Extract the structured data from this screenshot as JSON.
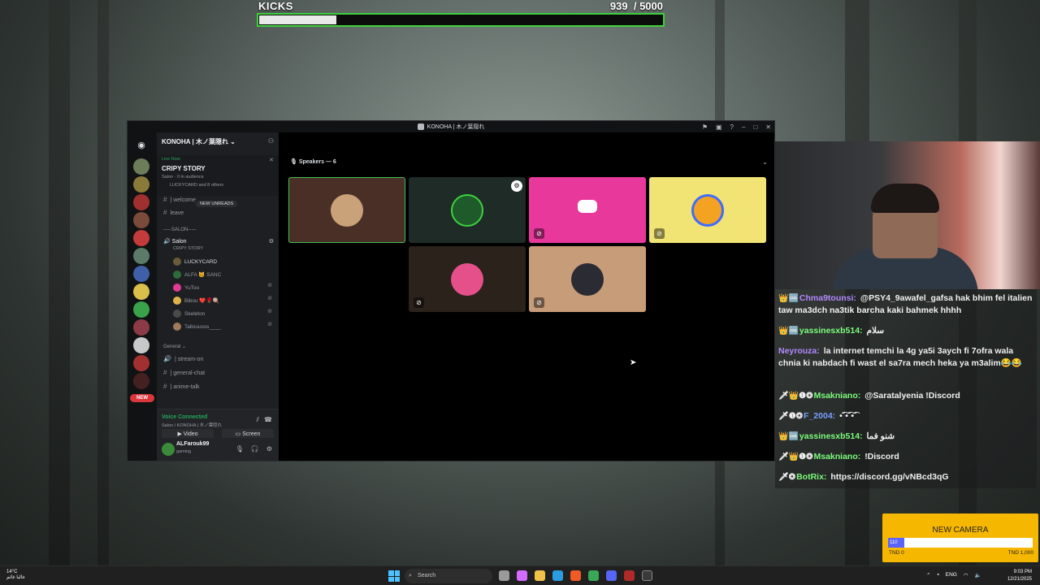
{
  "kicks": {
    "title": "KICKS",
    "count": "939",
    "goal": "/ 5000",
    "progress": 0.19
  },
  "discord": {
    "window_title": "KONOHA | 木ノ葉隠れ",
    "server_name": "KONOHA | 木ノ葉隠れ",
    "live_now": "Live Now",
    "live_title": "CRIPY STORY",
    "live_sub": "Salon · 0 in audience",
    "live_members": "LUCKYCARD and 8 others",
    "channels": {
      "welcome": "| welcome",
      "new_unreads": "NEW UNREADS",
      "leave": "leave",
      "salon_header": "-----SALON-----",
      "salon": "Salon",
      "salon_sub": "CRIPY STORY",
      "general_header": "General",
      "stream_on": "| stream-on",
      "general_chat": "| general-chat",
      "anime_talk": "| anime-talk"
    },
    "members": [
      "LUCKYCARD",
      "ALFA 🐱 SANC",
      "YuToo",
      "Bibou ❤️🌹🍭",
      "Skeleton",
      "Tallouusss____"
    ],
    "new_badge": "NEW",
    "voice": {
      "status": "Voice Connected",
      "path": "Salon / KONOHA | 木ノ葉隠れ",
      "video": "Video",
      "screen": "Screen"
    },
    "user": {
      "name": "ALFarouk99",
      "status": "gaming"
    },
    "stage": {
      "speakers": "Speakers — 6"
    }
  },
  "chat": [
    {
      "name": "Chma9tounsi:",
      "name_color": "#b388ff",
      "text": "@PSY4_9awafel_gafsa hak bhim fel italien taw ma3dch na3tik barcha kaki bahmek hhhh",
      "icons": "👑🆒"
    },
    {
      "name": "yassinesxb514:",
      "name_color": "#7cfc7c",
      "text": "سلام",
      "icons": "👑🆒"
    },
    {
      "name": "Neyrouza:",
      "name_color": "#b388ff",
      "text": "la internet temchi la 4g ya5i 3aych fi 7ofra wala chnia ki nabdach fi wast el sa7ra mech heka ya m3alim😂😂",
      "icons": ""
    },
    {
      "name": "Msakniano:",
      "name_color": "#7cfc7c",
      "text": "@Saratalyenia !Discord",
      "icons": "🗡👑❶❂"
    },
    {
      "name": "F_2004:",
      "name_color": "#7aa0ff",
      "text": "•͡˘•͡˘•͡˘",
      "icons": "🗡❶❂"
    },
    {
      "name": "yassinesxb514:",
      "name_color": "#7cfc7c",
      "text": "شنو فما",
      "icons": "👑🆒"
    },
    {
      "name": "Msakniano:",
      "name_color": "#7cfc7c",
      "text": "!Discord",
      "icons": "🗡👑❶❂"
    },
    {
      "name": "BotRix:",
      "name_color": "#7cfc7c",
      "text": "https://discord.gg/vNBcd3qG",
      "icons": "🗡❂"
    }
  ],
  "new_camera": {
    "title": "NEW CAMERA",
    "progress_label": "110",
    "progress": 0.11,
    "low": "TND 0",
    "high": "TND 1,000"
  },
  "taskbar": {
    "temp": "14°C",
    "weather": "غالبا غائم",
    "search": "Search",
    "lang": "ENG",
    "time": "9:03 PM",
    "date": "12/21/2025"
  }
}
